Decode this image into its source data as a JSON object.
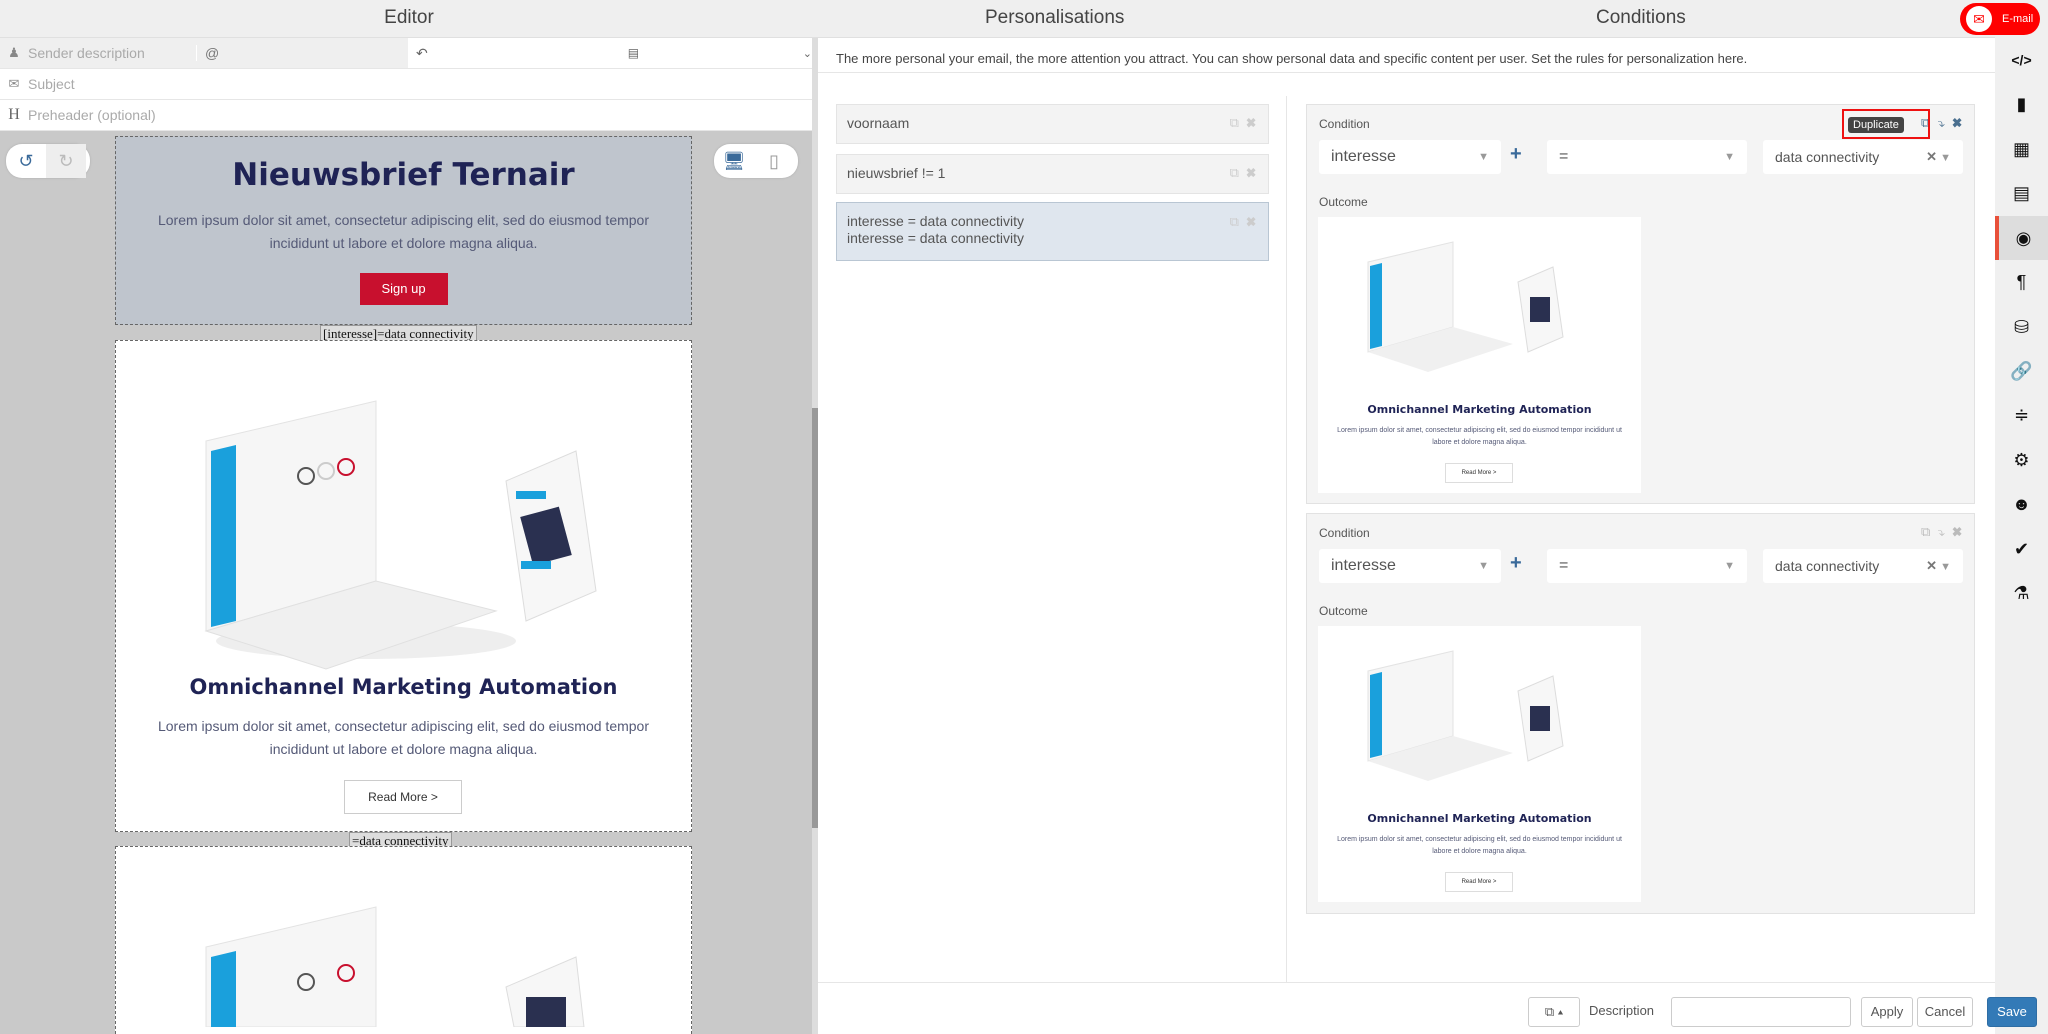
{
  "editor": {
    "title": "Editor",
    "sender_placeholder": "Sender description",
    "at": "@",
    "subject_placeholder": "Subject",
    "preheader_placeholder": "Preheader (optional)"
  },
  "email": {
    "hero_title": "Nieuwsbrief Ternair",
    "hero_text": "Lorem ipsum dolor sit amet, consectetur adipiscing elit, sed do eiusmod tempor incididunt ut labore et dolore magna aliqua.",
    "signup": "Sign up",
    "label1": "[interesse]=data connectivity",
    "card_title": "Omnichannel Marketing Automation",
    "card_text": "Lorem ipsum dolor sit amet, consectetur adipiscing elit, sed do eiusmod tempor incididunt ut labore et dolore magna aliqua.",
    "read_more": "Read More >",
    "label2": "=data connectivity"
  },
  "header": {
    "personalisations": "Personalisations",
    "conditions": "Conditions",
    "email_badge": "E-mail"
  },
  "info": "The more personal your email, the more attention you attract. You can show personal data and specific content per user. Set the rules for personalization here.",
  "list": [
    {
      "line1": "voornaam"
    },
    {
      "line1": "nieuwsbrief != 1"
    },
    {
      "line1": "interesse = data connectivity",
      "line2": "interesse = data connectivity"
    }
  ],
  "conditions": [
    {
      "label": "Condition",
      "field": "interesse",
      "op": "=",
      "value": "data connectivity",
      "outcome": "Outcome"
    },
    {
      "label": "Condition",
      "field": "interesse",
      "op": "=",
      "value": "data connectivity",
      "outcome": "Outcome"
    }
  ],
  "tooltip": "Duplicate",
  "footer": {
    "description_label": "Description",
    "description_value": "",
    "apply": "Apply",
    "cancel": "Cancel",
    "save": "Save"
  },
  "colors": {
    "accent": "#337ab7",
    "brand_red": "#c8102e",
    "badge_red": "#ff0000"
  }
}
